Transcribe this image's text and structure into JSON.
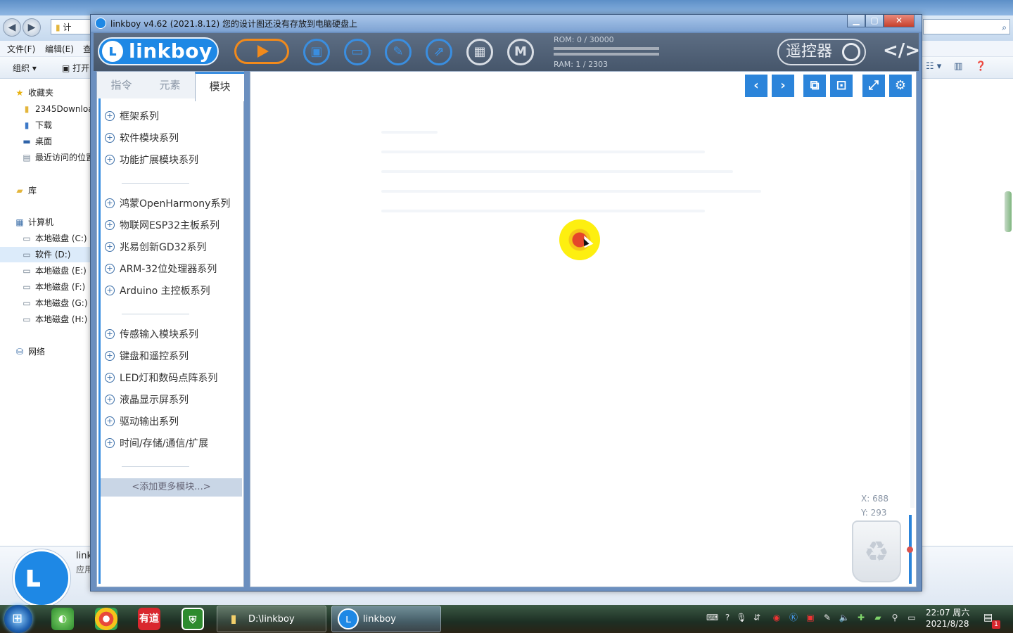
{
  "explorer": {
    "address_crumb": "计",
    "menu": [
      "文件(F)",
      "编辑(E)",
      "查"
    ],
    "toolbar": {
      "organize": "组织 ▾",
      "open": "打开"
    },
    "nav": {
      "favorites": "收藏夹",
      "favorite_items": [
        "2345Downloa",
        "下载",
        "桌面",
        "最近访问的位置"
      ],
      "library": "库",
      "computer": "计算机",
      "drives": [
        "本地磁盘 (C:)",
        "软件 (D:)",
        "本地磁盘 (E:)",
        "本地磁盘 (F:)",
        "本地磁盘 (G:)",
        "本地磁盘 (H:)"
      ],
      "network": "网络"
    },
    "details": {
      "name": "link",
      "type": "应用"
    }
  },
  "linkboy": {
    "window_title": "linkboy v4.62 (2021.8.12) 您的设计图还没有存放到电脑硬盘上",
    "logo_text": "linkboy",
    "rom": "ROM: 0 / 30000",
    "ram": "RAM: 1 / 2303",
    "remote_label": "遥控器",
    "code_label": "</>",
    "tabs": [
      "指令",
      "元素",
      "模块"
    ],
    "active_tab": "模块",
    "module_groups": [
      [
        "框架系列",
        "软件模块系列",
        "功能扩展模块系列"
      ],
      [
        "鸿蒙OpenHarmony系列",
        "物联网ESP32主板系列",
        "兆易创新GD32系列",
        "ARM-32位处理器系列",
        "Arduino 主控板系列"
      ],
      [
        "传感输入模块系列",
        "键盘和遥控系列",
        "LED灯和数码点阵系列",
        "液晶显示屏系列",
        "驱动输出系列",
        "时间/存储/通信/扩展"
      ]
    ],
    "add_more": "<添加更多模块...>",
    "coord_x": "X: 688",
    "coord_y": "Y: 293"
  },
  "taskbar": {
    "tasks": [
      {
        "label": "D:\\linkboy",
        "icon": "folder-icon"
      },
      {
        "label": "linkboy",
        "icon": "linkboy-icon"
      }
    ],
    "pinned": [
      "youdao-icon-label"
    ],
    "youdao_label": "有道",
    "clock_time": "22:07 周六",
    "clock_date": "2021/8/28",
    "notify_count": "1"
  },
  "colors": {
    "accent": "#3a8ee0",
    "run": "#f28a1b",
    "toolbar_bg": "#4f5f74",
    "cursor_highlight": "#fdef10"
  }
}
